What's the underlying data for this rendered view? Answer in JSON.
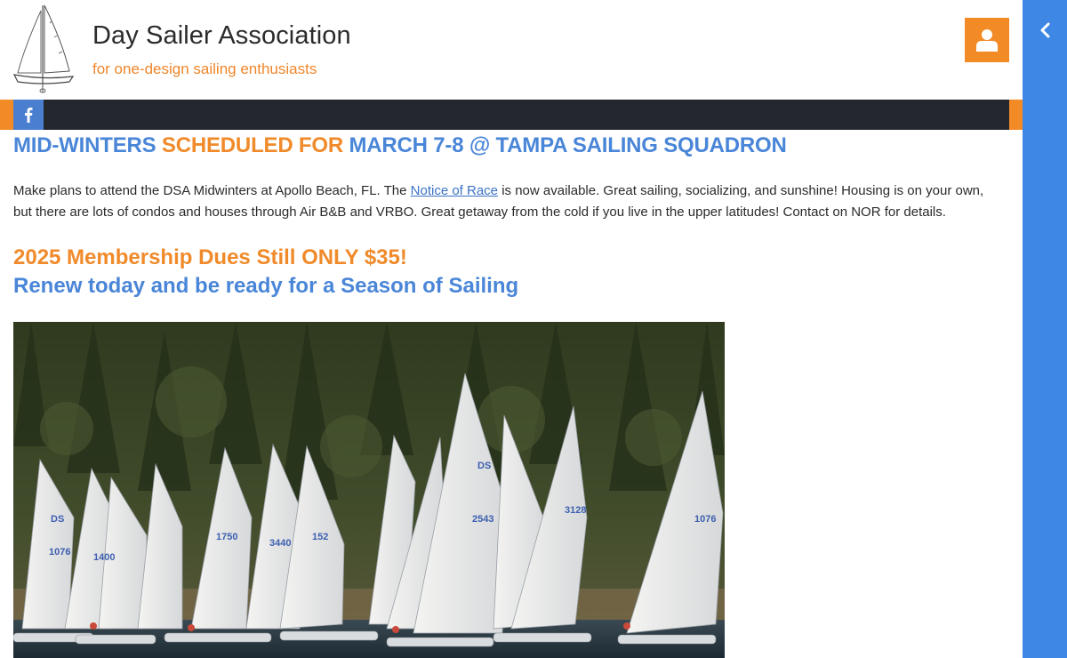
{
  "site": {
    "title": "Day Sailer Association",
    "tagline": "for one-design sailing enthusiasts"
  },
  "icons": {
    "logo": "sailboat-logo",
    "user": "user-icon",
    "facebook": "facebook-icon",
    "drawer": "chevron-left-icon"
  },
  "colors": {
    "accent_orange": "#f28a26",
    "accent_blue": "#4a86d8",
    "navbar_dark": "#24272e",
    "drawer_blue": "#3f87e5"
  },
  "headline": {
    "part1": "MID-WINTERS ",
    "part2": "SCHEDULED FOR ",
    "part3": "MARCH 7-8 @ TAMPA SAILING SQUADRON"
  },
  "intro": {
    "before_link": "Make plans to attend the DSA Midwinters at Apollo Beach, FL. The ",
    "link_text": "Notice of Race",
    "after_link": " is now available. Great sailing, socializing, and sunshine! Housing is on your own, but there are lots of condos and houses through Air B&B and VRBO. Great getaway from the cold if you live in the upper latitudes! Contact on NOR for details."
  },
  "membership": {
    "dues_heading": "2025 Membership Dues Still ONLY $35!",
    "renew_heading": "Renew today and be ready for a Season of Sailing"
  },
  "photo": {
    "sail_labels": [
      "DS",
      "1076",
      "1400",
      "1750",
      "3440",
      "152",
      "DS",
      "2543",
      "3128",
      "1076"
    ]
  }
}
